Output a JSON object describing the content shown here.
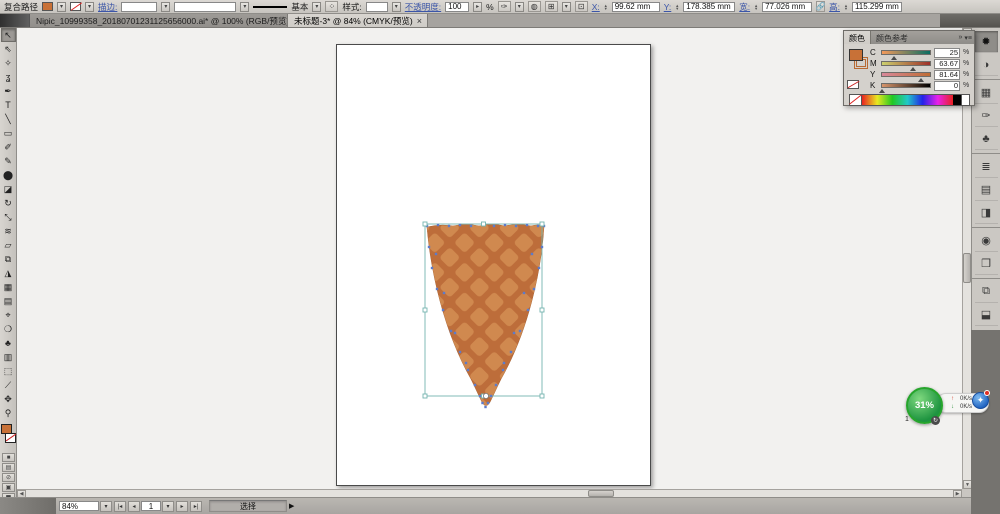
{
  "control_bar": {
    "context_label": "复合路径",
    "stroke_label": "描边:",
    "brush_name": "基本",
    "style_label": "样式:",
    "opacity_label": "不透明度:",
    "opacity_value": "100",
    "percent": "%",
    "x_label": "X:",
    "x_value": "99.62 mm",
    "y_label": "Y:",
    "y_value": "178.385 mm",
    "w_label": "宽:",
    "w_value": "77.026 mm",
    "h_label": "高:",
    "h_value": "115.299 mm",
    "dropdown_glyph": "▾"
  },
  "tabs": [
    {
      "title": "Nipic_10999358_20180701231125656000.ai* @ 100% (RGB/预览)",
      "close": "×",
      "active": false
    },
    {
      "title": "未标题-3* @ 84% (CMYK/预览)",
      "close": "×",
      "active": true
    }
  ],
  "tools": {
    "items": [
      {
        "name": "selection-tool",
        "glyph": "↖"
      },
      {
        "name": "direct-selection-tool",
        "glyph": "⇖"
      },
      {
        "name": "magic-wand-tool",
        "glyph": "✧"
      },
      {
        "name": "lasso-tool",
        "glyph": "ʓ"
      },
      {
        "name": "pen-tool",
        "glyph": "✒"
      },
      {
        "name": "type-tool",
        "glyph": "T"
      },
      {
        "name": "line-segment-tool",
        "glyph": "╲"
      },
      {
        "name": "rectangle-tool",
        "glyph": "▭"
      },
      {
        "name": "paintbrush-tool",
        "glyph": "✐"
      },
      {
        "name": "pencil-tool",
        "glyph": "✎"
      },
      {
        "name": "blob-brush-tool",
        "glyph": "⬤"
      },
      {
        "name": "eraser-tool",
        "glyph": "◪"
      },
      {
        "name": "rotate-tool",
        "glyph": "↻"
      },
      {
        "name": "scale-tool",
        "glyph": "⤡"
      },
      {
        "name": "width-tool",
        "glyph": "≋"
      },
      {
        "name": "free-transform-tool",
        "glyph": "▱"
      },
      {
        "name": "shape-builder-tool",
        "glyph": "⧉"
      },
      {
        "name": "perspective-grid-tool",
        "glyph": "◮"
      },
      {
        "name": "mesh-tool",
        "glyph": "▦"
      },
      {
        "name": "gradient-tool",
        "glyph": "▤"
      },
      {
        "name": "eyedropper-tool",
        "glyph": "⌖"
      },
      {
        "name": "blend-tool",
        "glyph": "❍"
      },
      {
        "name": "symbol-sprayer-tool",
        "glyph": "♣"
      },
      {
        "name": "column-graph-tool",
        "glyph": "▥"
      },
      {
        "name": "artboard-tool",
        "glyph": "⬚"
      },
      {
        "name": "slice-tool",
        "glyph": "⟋"
      },
      {
        "name": "hand-tool",
        "glyph": "✥"
      },
      {
        "name": "zoom-tool",
        "glyph": "⚲"
      }
    ]
  },
  "dock": {
    "items": [
      {
        "name": "color-panel",
        "glyph": "✹",
        "selected": true
      },
      {
        "name": "color-guide-panel",
        "glyph": "◑"
      },
      {
        "name": "swatches-panel",
        "glyph": "▦"
      },
      {
        "name": "brushes-panel",
        "glyph": "✑"
      },
      {
        "name": "symbols-panel",
        "glyph": "♣"
      },
      {
        "name": "stroke-panel",
        "glyph": "≣"
      },
      {
        "name": "gradient-panel",
        "glyph": "▤"
      },
      {
        "name": "transparency-panel",
        "glyph": "◨"
      },
      {
        "name": "appearance-panel",
        "glyph": "◉"
      },
      {
        "name": "graphic-styles-panel",
        "glyph": "❒"
      },
      {
        "name": "layers-panel",
        "glyph": "⧉"
      },
      {
        "name": "artboards-panel",
        "glyph": "⬓"
      }
    ]
  },
  "color_panel": {
    "tab_color": "颜色",
    "tab_color_guide": "颜色参考",
    "chevrons": "»",
    "menu_glyph": "▾≡",
    "sliders": [
      {
        "label": "C",
        "value": "25",
        "value_pct": 25,
        "unit": "%"
      },
      {
        "label": "M",
        "value": "63.67",
        "value_pct": 63.67,
        "unit": "%"
      },
      {
        "label": "Y",
        "value": "81.64",
        "value_pct": 81.64,
        "unit": "%"
      },
      {
        "label": "K",
        "value": "0",
        "value_pct": 0,
        "unit": "%"
      }
    ]
  },
  "status_bar": {
    "zoom_value": "84%",
    "first_glyph": "|◂",
    "prev_glyph": "◂",
    "artboard_value": "1",
    "next_glyph": "▸",
    "last_glyph": "▸|",
    "tool_name": "选择",
    "flyout_glyph": "▶"
  },
  "overlay": {
    "percent": "31%",
    "up_arrow": "↑",
    "up_speed": "0K/s",
    "down_arrow": "↓",
    "down_speed": "0K/s",
    "count": "1",
    "refresh_glyph": "↻",
    "accelerator_glyph": "✦"
  },
  "colors": {
    "fill_orange": "#c87137",
    "cone_dark": "#bd6d3a",
    "cone_light": "#d0894f",
    "anchor_blue": "#5d7bc9",
    "selection_teal": "#74b4b0"
  }
}
